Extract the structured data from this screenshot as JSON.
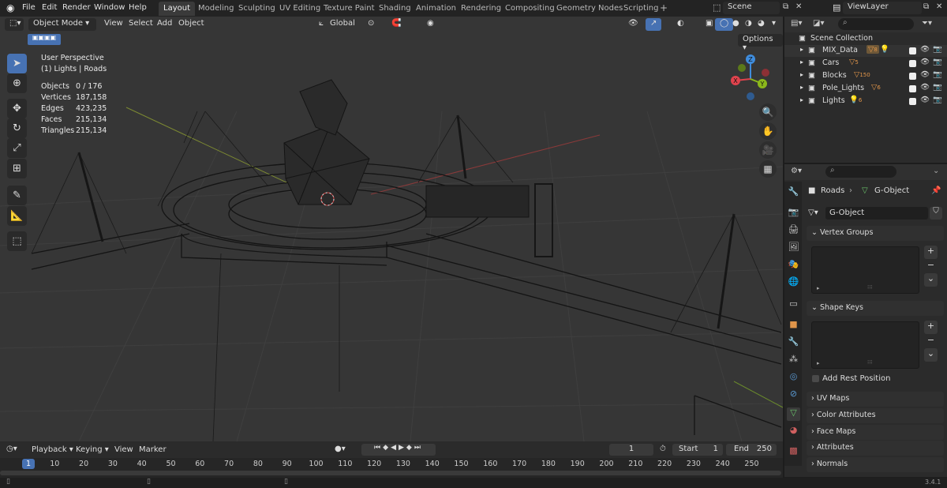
{
  "menu": [
    "File",
    "Edit",
    "Render",
    "Window",
    "Help"
  ],
  "workspaces": [
    {
      "label": "Layout",
      "active": true
    },
    {
      "label": "Modeling"
    },
    {
      "label": "Sculpting"
    },
    {
      "label": "UV Editing"
    },
    {
      "label": "Texture Paint"
    },
    {
      "label": "Shading"
    },
    {
      "label": "Animation"
    },
    {
      "label": "Rendering"
    },
    {
      "label": "Compositing"
    },
    {
      "label": "Geometry Nodes"
    },
    {
      "label": "Scripting"
    }
  ],
  "add_tab": "+",
  "scene": "Scene",
  "view_layer": "ViewLayer",
  "viewport_header": {
    "mode": "Object Mode",
    "view": "View",
    "select": "Select",
    "add": "Add",
    "object": "Object",
    "orientation": "Global",
    "options": "Options"
  },
  "overlay_info": {
    "perspective": "User Perspective",
    "collection": "(1) Lights | Roads"
  },
  "stats": [
    {
      "label": "Objects",
      "value": "0 / 176"
    },
    {
      "label": "Vertices",
      "value": "187,158"
    },
    {
      "label": "Edges",
      "value": "423,235"
    },
    {
      "label": "Faces",
      "value": "215,134"
    },
    {
      "label": "Triangles",
      "value": "215,134"
    }
  ],
  "gizmo": {
    "x": "X",
    "y": "Y",
    "z": "Z"
  },
  "outliner": {
    "root": "Scene Collection",
    "items": [
      {
        "name": "MIX_Data",
        "badge": "8"
      },
      {
        "name": "Cars",
        "badge": "5"
      },
      {
        "name": "Blocks",
        "badge": "150"
      },
      {
        "name": "Pole_Lights",
        "badge": "6"
      },
      {
        "name": "Lights",
        "badge": "6"
      }
    ]
  },
  "properties": {
    "breadcrumb_obj": "Roads",
    "breadcrumb_data": "G-Object",
    "mesh_name": "G-Object",
    "panels": {
      "vertex_groups": "Vertex Groups",
      "shape_keys": "Shape Keys",
      "add_rest_position": "Add Rest Position",
      "uv_maps": "UV Maps",
      "color_attributes": "Color Attributes",
      "face_maps": "Face Maps",
      "attributes": "Attributes",
      "normals": "Normals"
    }
  },
  "timeline": {
    "playback": "Playback",
    "keying": "Keying",
    "view": "View",
    "marker": "Marker",
    "current_frame": "1",
    "start_label": "Start",
    "start": "1",
    "end_label": "End",
    "end": "250",
    "ruler": [
      "1",
      "10",
      "20",
      "30",
      "40",
      "50",
      "60",
      "70",
      "80",
      "90",
      "100",
      "110",
      "120",
      "130",
      "140",
      "150",
      "160",
      "170",
      "180",
      "190",
      "200",
      "210",
      "220",
      "230",
      "240",
      "250"
    ]
  },
  "version": "3.4.1",
  "colors": {
    "accent": "#4772b3",
    "x_axis": "#e0434d",
    "y_axis": "#8bb81b",
    "z_axis": "#3f8dde"
  }
}
